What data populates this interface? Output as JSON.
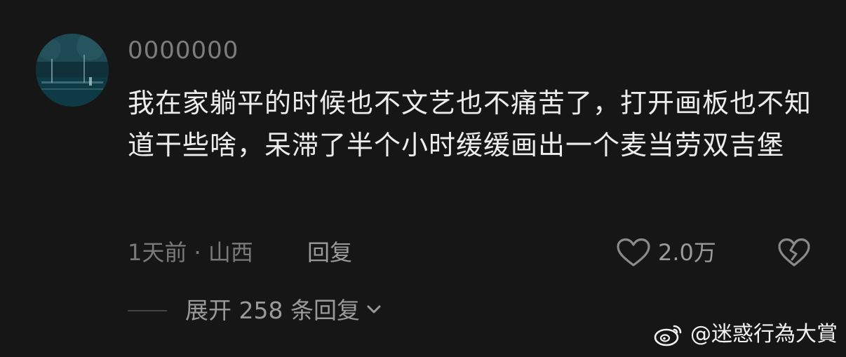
{
  "comment": {
    "avatar_icon": "user-avatar-icon",
    "username": "0000000",
    "text": "我在家躺平的时候也不文艺也不痛苦了，打开画板也不知道干些啥，呆滞了半个小时缓缓画出一个麦当劳双吉堡",
    "meta": "1天前 · 山西",
    "reply_label": "回复",
    "like_icon": "heart-icon",
    "like_count": "2.0万",
    "dislike_icon": "broken-heart-icon"
  },
  "replies": {
    "expand_label": "展开 258 条回复",
    "expand_icon": "chevron-down-icon"
  },
  "watermark": {
    "icon": "weibo-logo-icon",
    "text": "@迷惑行為大賞"
  },
  "colors": {
    "background": "#161616",
    "primary_text": "#ededed",
    "secondary_text": "#7a7a7a",
    "action_text": "#9a9a9a"
  }
}
